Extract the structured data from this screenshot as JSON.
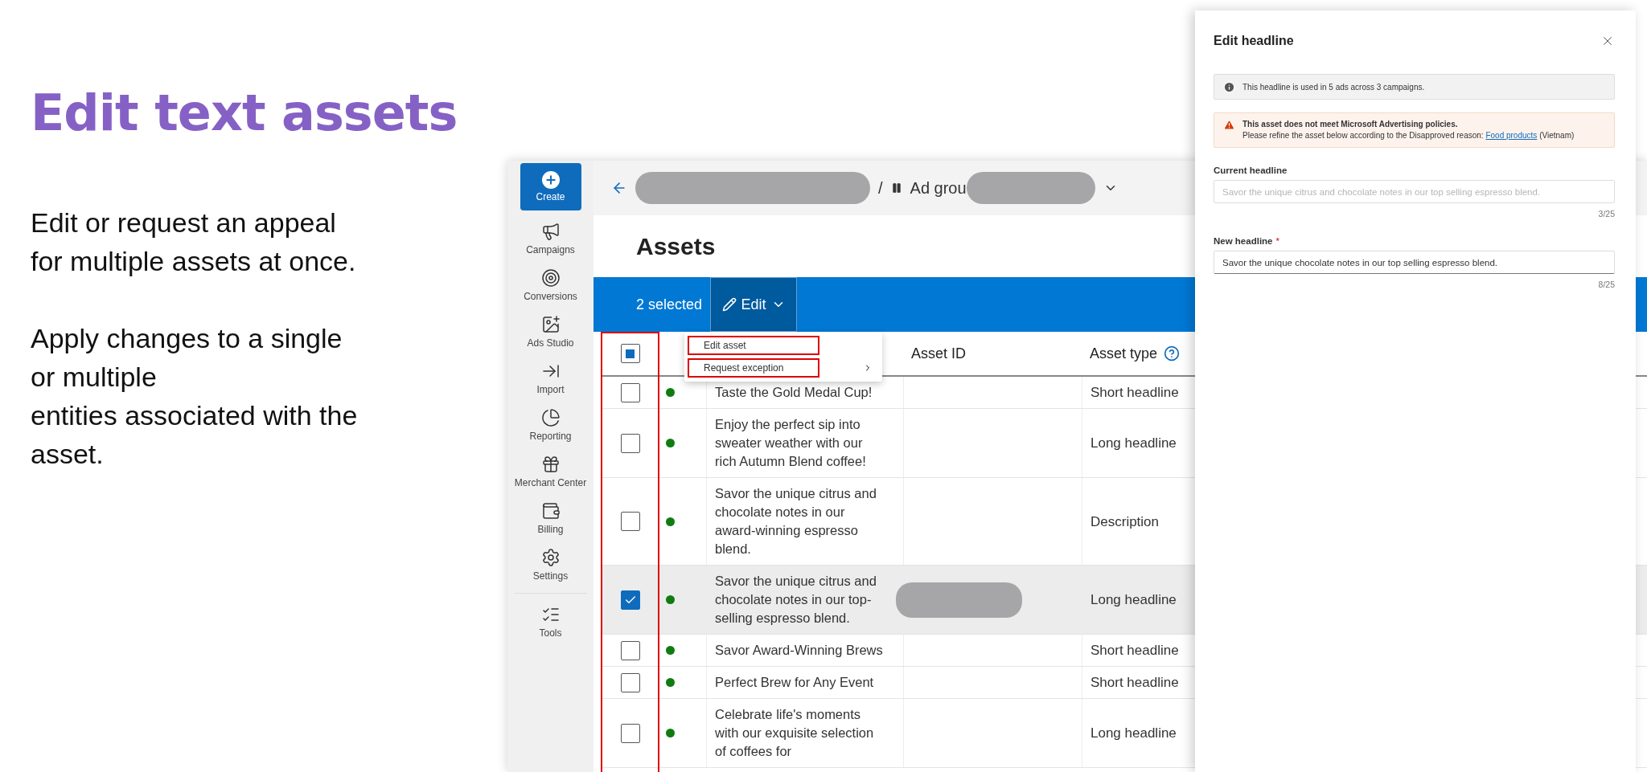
{
  "slide": {
    "title": "Edit text assets",
    "paragraphs": [
      "Edit or request an appeal\nfor multiple assets at once.",
      "Apply changes to a single\nor multiple\nentities associated with the\nasset."
    ]
  },
  "sidebar": {
    "create": "Create",
    "items": [
      {
        "label": "Campaigns"
      },
      {
        "label": "Conversions"
      },
      {
        "label": "Ads Studio"
      },
      {
        "label": "Import"
      },
      {
        "label": "Reporting"
      },
      {
        "label": "Merchant Center"
      },
      {
        "label": "Billing"
      },
      {
        "label": "Settings"
      },
      {
        "label": "Tools"
      }
    ]
  },
  "breadcrumb": {
    "separator": "/",
    "ad_group": "Ad grou"
  },
  "page_title": "Assets",
  "selection_bar": {
    "count": "2 selected",
    "edit": "Edit"
  },
  "menu": [
    {
      "label": "Edit asset",
      "highlighted": true,
      "submenu": false
    },
    {
      "label": "Request exception",
      "highlighted": true,
      "submenu": true
    }
  ],
  "table": {
    "checkbox_column_highlighted": true,
    "header_checkbox": {
      "indeterminate": true
    },
    "columns": [
      {
        "label": "Asset ID",
        "help": false
      },
      {
        "label": "Asset type",
        "help": true
      }
    ],
    "rows": [
      {
        "selected": false,
        "text": "Taste the Gold Medal Cup!",
        "id_redacted": false,
        "type": "Short headline"
      },
      {
        "selected": false,
        "text": "Enjoy the perfect sip into sweater weather with our rich Autumn Blend coffee!",
        "id_redacted": false,
        "type": "Long headline"
      },
      {
        "selected": false,
        "text": "Savor the unique citrus and chocolate notes in our award-winning espresso blend.",
        "id_redacted": false,
        "type": "Description"
      },
      {
        "selected": true,
        "text": "Savor the unique citrus and chocolate notes in our top-selling espresso blend.",
        "id_redacted": true,
        "type": "Long headline"
      },
      {
        "selected": false,
        "text": "Savor Award-Winning Brews",
        "id_redacted": false,
        "type": "Short headline"
      },
      {
        "selected": false,
        "text": "Perfect Brew for Any Event",
        "id_redacted": false,
        "type": "Short headline"
      },
      {
        "selected": false,
        "text": "Celebrate life's moments with our exquisite selection of coffees for",
        "id_redacted": false,
        "type": "Long headline"
      }
    ]
  },
  "panel": {
    "title": "Edit headline",
    "info": "This headline is used in 5 ads across 3 campaigns.",
    "warning": {
      "title": "This asset does not meet Microsoft Advertising policies.",
      "text": "Please refine the asset below according to the Disapproved reason:",
      "link": "Food products",
      "suffix": "(Vietnam)"
    },
    "fields": [
      {
        "label": "Current headline",
        "disabled": true,
        "value": "Savor the unique citrus and chocolate notes in our top selling espresso blend.",
        "count": "3/25"
      },
      {
        "label": "New headline",
        "required_mark": "*",
        "disabled": false,
        "value": "Savor the unique chocolate notes in our top selling espresso blend.",
        "count": "8/25"
      }
    ]
  }
}
